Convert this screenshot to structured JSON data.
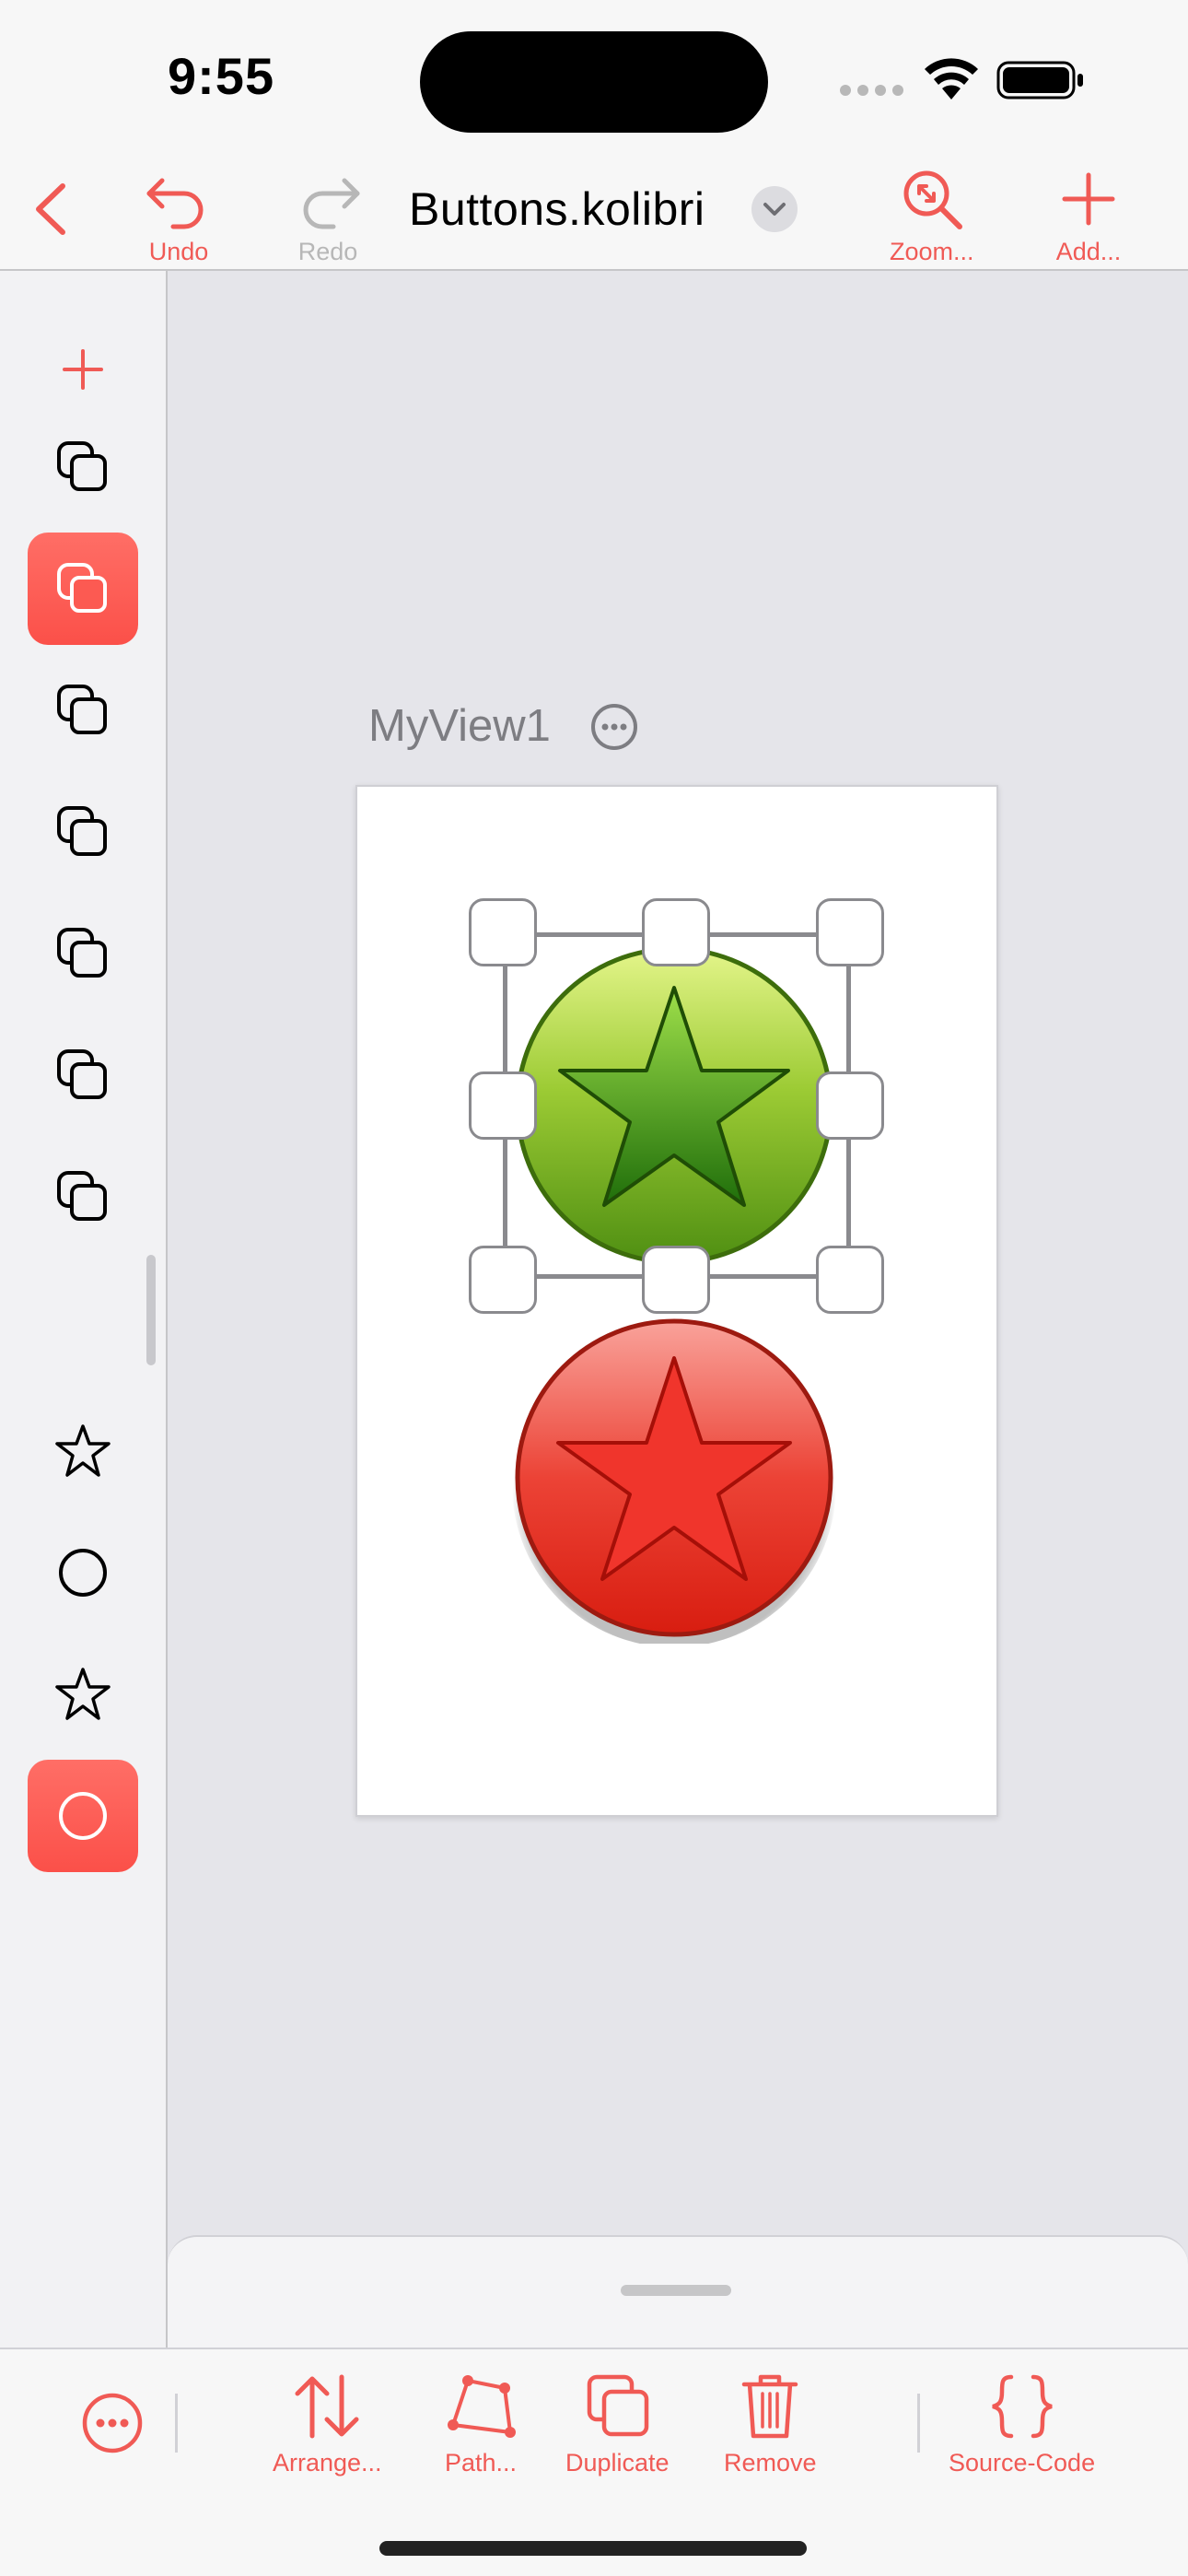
{
  "status_bar": {
    "time": "9:55"
  },
  "toolbar": {
    "back_label": "",
    "undo_label": "Undo",
    "redo_label": "Redo",
    "title": "Buttons.kolibri",
    "zoom_label": "Zoom...",
    "add_label": "Add..."
  },
  "sidebar": {
    "items": [
      {
        "icon": "plus-icon",
        "selected": false
      },
      {
        "icon": "layers-icon",
        "selected": false
      },
      {
        "icon": "layers-icon",
        "selected": true
      },
      {
        "icon": "layers-icon",
        "selected": false
      },
      {
        "icon": "layers-icon",
        "selected": false
      },
      {
        "icon": "layers-icon",
        "selected": false
      },
      {
        "icon": "layers-icon",
        "selected": false
      },
      {
        "icon": "layers-icon",
        "selected": false
      },
      {
        "icon": "star-icon",
        "selected": false
      },
      {
        "icon": "circle-icon",
        "selected": false
      },
      {
        "icon": "star-icon",
        "selected": false
      },
      {
        "icon": "circle-icon",
        "selected": true
      }
    ]
  },
  "canvas": {
    "view_name": "MyView1"
  },
  "bottom_toolbar": {
    "arrange_label": "Arrange...",
    "path_label": "Path...",
    "duplicate_label": "Duplicate",
    "remove_label": "Remove",
    "source_code_label": "Source-Code"
  },
  "colors": {
    "accent": "#f05a55",
    "green_button": "#7dbb2a",
    "red_button": "#e8382d"
  }
}
